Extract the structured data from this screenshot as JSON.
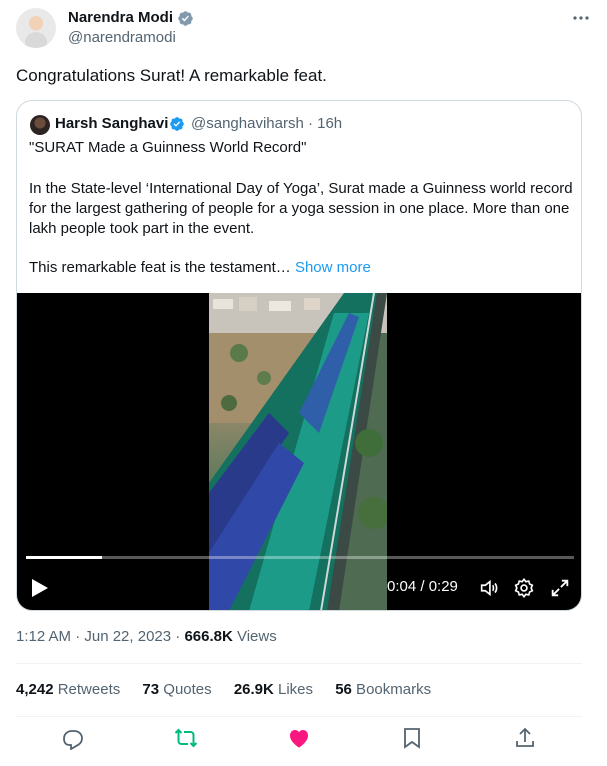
{
  "author": {
    "name": "Narendra Modi",
    "handle": "@narendramodi",
    "verified": true
  },
  "tweet": {
    "text": "Congratulations Surat! A remarkable feat."
  },
  "quoted": {
    "name": "Harsh Sanghavi",
    "meta": "@sanghaviharsh · 16h",
    "line1": "\"SURAT Made a Guinness World Record\"",
    "paragraph": "In the State-level ‘International Day of Yoga’, Surat made a Guinness world record for the largest gathering of people for a yoga session in one place. More than one lakh people took part in the event.",
    "last_line": "This remarkable feat is the testament… ",
    "show_more": "Show more"
  },
  "video": {
    "time": "0:04 / 0:29",
    "progress_fraction": 0.138
  },
  "meta": {
    "timestamp": "1:12 AM · Jun 22, 2023 · ",
    "views_count": "666.8K",
    "views_label": " Views"
  },
  "stats": [
    {
      "count": "4,242",
      "label": " Retweets"
    },
    {
      "count": "73",
      "label": " Quotes"
    },
    {
      "count": "26.9K",
      "label": " Likes"
    },
    {
      "count": "56",
      "label": " Bookmarks"
    }
  ],
  "colors": {
    "accent": "#1d9bf0",
    "retweet_green": "#00ba7c",
    "like_pink": "#f91880",
    "muted": "#536471"
  },
  "icons": [
    "verified-badge-icon",
    "more-dots-icon",
    "play-icon",
    "volume-icon",
    "settings-icon",
    "fullscreen-icon",
    "reply-icon",
    "retweet-icon",
    "like-icon",
    "bookmark-icon",
    "share-icon"
  ]
}
